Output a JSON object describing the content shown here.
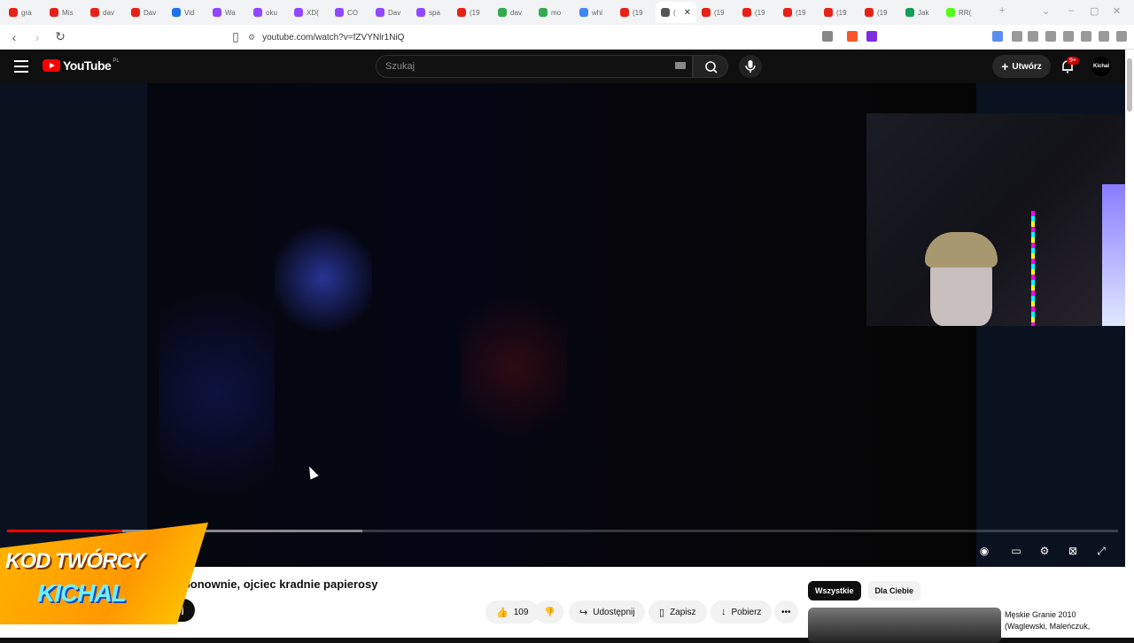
{
  "browser": {
    "tabs": [
      {
        "label": "gra",
        "color": "#e62117"
      },
      {
        "label": "Mis",
        "color": "#e62117"
      },
      {
        "label": "dav",
        "color": "#e62117"
      },
      {
        "label": "Dav",
        "color": "#e62117"
      },
      {
        "label": "Vid",
        "color": "#1a73e8"
      },
      {
        "label": "Wa",
        "color": "#9146ff"
      },
      {
        "label": "oku",
        "color": "#9146ff"
      },
      {
        "label": "XD(",
        "color": "#9146ff"
      },
      {
        "label": "CO",
        "color": "#9146ff"
      },
      {
        "label": "Dav",
        "color": "#9146ff"
      },
      {
        "label": "spa",
        "color": "#9146ff"
      },
      {
        "label": "(19",
        "color": "#e62117"
      },
      {
        "label": "dav",
        "color": "#34a853"
      },
      {
        "label": "mo",
        "color": "#34a853"
      },
      {
        "label": "whi",
        "color": "#4285f4"
      },
      {
        "label": "(19",
        "color": "#e62117"
      },
      {
        "label": "(",
        "color": "#555555",
        "active": true
      },
      {
        "label": "(19",
        "color": "#e62117"
      },
      {
        "label": "(19",
        "color": "#e62117"
      },
      {
        "label": "(19",
        "color": "#e62117"
      },
      {
        "label": "(19",
        "color": "#e62117"
      },
      {
        "label": "(19",
        "color": "#e62117"
      },
      {
        "label": "Jak",
        "color": "#0f9d58"
      },
      {
        "label": "RR(",
        "color": "#53fc18"
      }
    ],
    "url": "youtube.com/watch?v=fZVYNlr1NiQ"
  },
  "header": {
    "logo_text": "YouTube",
    "country": "PL",
    "search_placeholder": "Szukaj",
    "create_label": "Utwórz",
    "notif_count": "9+",
    "avatar_text": "Kichal"
  },
  "player": {
    "progress_fraction": 0.104,
    "buffered_fraction": 0.32
  },
  "promo": {
    "line1": "KOD TWÓRCY",
    "line2": "KICHAL"
  },
  "video": {
    "title": "e ponownie, ojciec kradnie papierosy",
    "subscribe_label": "ubskrybuj",
    "likes": "109",
    "share_label": "Udostępnij",
    "save_label": "Zapisz",
    "download_label": "Pobierz"
  },
  "sidebar": {
    "chips": [
      "Wszystkie",
      "Dla Ciebie"
    ],
    "rec_title": "Męskie Granie 2010 (Waglewski, Maleńczuk,"
  }
}
